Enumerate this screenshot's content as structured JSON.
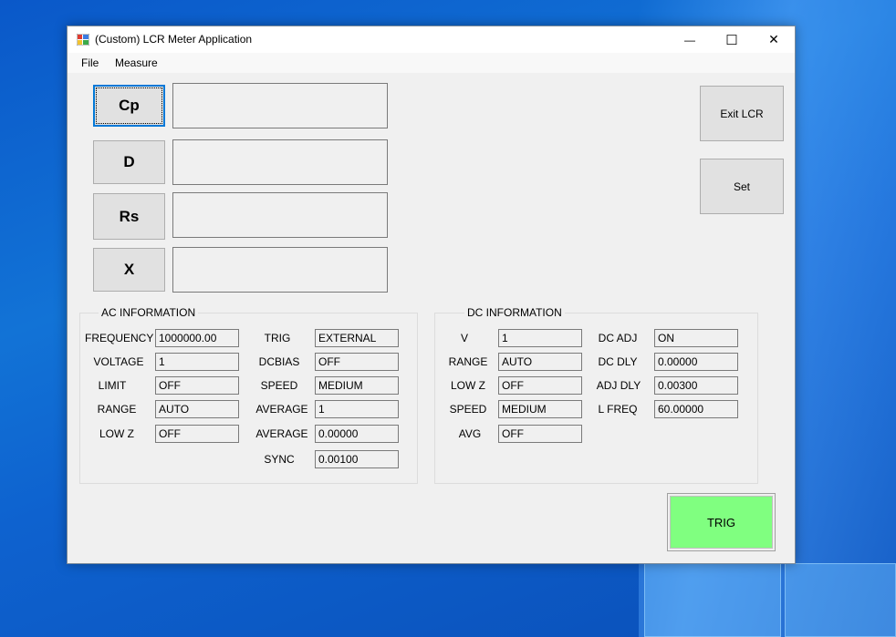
{
  "window": {
    "title": "(Custom) LCR Meter Application",
    "minimize": "—",
    "maximize": "☐",
    "close": "✕"
  },
  "menu": {
    "file": "File",
    "measure": "Measure"
  },
  "measure_buttons": {
    "cp": "Cp",
    "d": "D",
    "rs": "Rs",
    "x": "X"
  },
  "measure_values": {
    "cp": "",
    "d": "",
    "rs": "",
    "x": ""
  },
  "actions": {
    "exit": "Exit LCR",
    "set": "Set",
    "trig": "TRIG"
  },
  "ac": {
    "title": "AC INFORMATION",
    "frequency_label": "FREQUENCY",
    "frequency": "1000000.00",
    "voltage_label": "VOLTAGE",
    "voltage": "1",
    "limit_label": "LIMIT",
    "limit": "OFF",
    "range_label": "RANGE",
    "range": "AUTO",
    "lowz_label": "LOW Z",
    "lowz": "OFF",
    "trig_label": "TRIG",
    "trig": "EXTERNAL",
    "dcbias_label": "DCBIAS",
    "dcbias": "OFF",
    "speed_label": "SPEED",
    "speed": "MEDIUM",
    "average_label": "AVERAGE",
    "average": "1",
    "average2_label": "AVERAGE",
    "average2": "0.00000",
    "sync_label": "SYNC",
    "sync": "0.00100"
  },
  "dc": {
    "title": "DC INFORMATION",
    "v_label": "V",
    "v": "1",
    "range_label": "RANGE",
    "range": "AUTO",
    "lowz_label": "LOW Z",
    "lowz": "OFF",
    "speed_label": "SPEED",
    "speed": "MEDIUM",
    "avg_label": "AVG",
    "avg": "OFF",
    "dcadj_label": "DC ADJ",
    "dcadj": "ON",
    "dcdly_label": "DC DLY",
    "dcdly": "0.00000",
    "adjdly_label": "ADJ DLY",
    "adjdly": "0.00300",
    "lfreq_label": "L FREQ",
    "lfreq": "60.00000"
  },
  "colors": {
    "trig_bg": "#80ff80",
    "focus_border": "#0078d7",
    "desktop": "#0a58c9"
  }
}
